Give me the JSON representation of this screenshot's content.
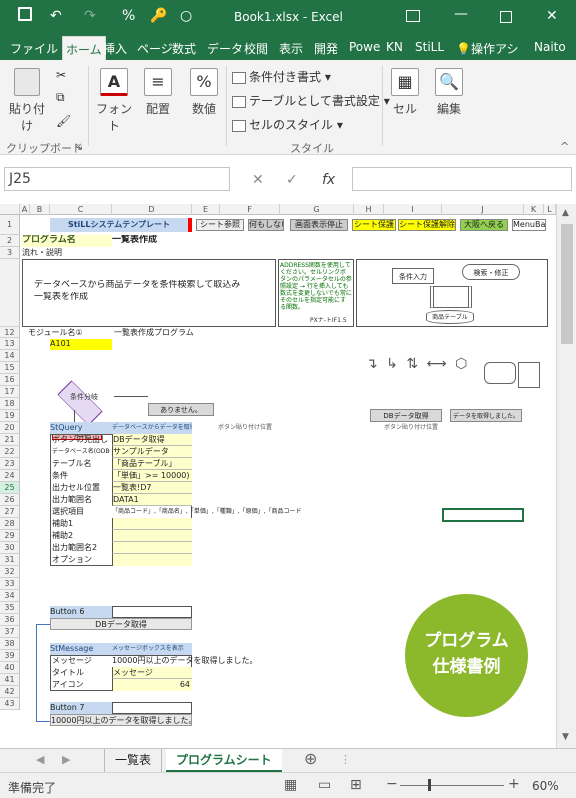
{
  "titlebar": {
    "title": "Book1.xlsx - Excel",
    "percent_icon": "%",
    "key_icon": "🔑",
    "circle_icon": "○"
  },
  "tabs": [
    "ファイル",
    "ホーム",
    "挿入",
    "ページ",
    "数式",
    "データ",
    "校閲",
    "表示",
    "開発",
    "Powe",
    "KN",
    "StiLL",
    "操作アシ",
    "Naito"
  ],
  "ribbon": {
    "paste": "貼り付け",
    "font": "フォント",
    "align": "配置",
    "number": "数値",
    "cond": "条件付き書式",
    "table": "テーブルとして書式設定",
    "style": "セルのスタイル",
    "cell": "セル",
    "edit": "編集",
    "clip_grp": "クリップボード",
    "style_grp": "スタイル",
    "font_glyph": "A",
    "num_glyph": "%"
  },
  "formula": {
    "namebox": "J25",
    "fx": "fx"
  },
  "cols": [
    "A",
    "B",
    "C",
    "D",
    "E",
    "F",
    "G",
    "H",
    "I",
    "J",
    "K",
    "L"
  ],
  "rows": [
    "1",
    "2",
    "3",
    "12",
    "13",
    "14",
    "15",
    "16",
    "17",
    "18",
    "19",
    "20",
    "21",
    "22",
    "23",
    "24",
    "25",
    "26",
    "27",
    "28",
    "29",
    "30",
    "31",
    "32",
    "33",
    "34",
    "35",
    "36",
    "37",
    "38",
    "39",
    "40",
    "41",
    "42",
    "43"
  ],
  "cells": {
    "template": "StiLLシステムテンプレート",
    "b1": "シート参照",
    "b2": "何もしない",
    "b3": "画面表示停止",
    "b4": "シート保護",
    "b5": "シート保護解除",
    "b6": "大阪へ戻る",
    "b7": "MenuBar",
    "prog_label": "プログラム名",
    "prog_name": "一覧表作成",
    "flow": "流れ・説明",
    "desc1": "データベースから商品データを条件検索して取込み",
    "desc2": "一覧表を作成",
    "note": "ADDRESS関数を使用してください。セルリンクボタンのパラメータセルの参照設定 → 行を挿入しても数式を変更しないでも常にそのセルを指定可能にする関数。",
    "note_footer": "PXナ-トIF1.5",
    "fc_input": "条件入力",
    "fc_search": "検索・修正",
    "fc_table": "商品テーブル",
    "mod_label": "モジュール名①",
    "mod_name": "一覧表作成プログラム",
    "a101": "A101",
    "cond_branch": "条件分岐",
    "none": "ありません。",
    "listbtn": "一覧表",
    "db_btn": "DBデータ取得",
    "db_ok": "データを取得しました。",
    "stq": "StQuery",
    "stq_desc": "データベースからデータを取得",
    "btn_pos1": "ボタン貼り付け位置",
    "btn_pos2": "ボタン貼り付け位置",
    "r21a": "ボタンの見出し",
    "r21b": "DBデータ取得",
    "r22a": "データベース名(ODBC)",
    "r22b": "サンプルデータ",
    "r23a": "テーブル名",
    "r23b": "「商品テーブル」",
    "r24a": "条件",
    "r24b": "「単価」>= 10000)",
    "r25a": "出力セル位置",
    "r25b": "一覧表!D7",
    "r26a": "出力範囲名",
    "r26b": "DATA1",
    "r27a": "選択項目",
    "r27b": "「商品コード」,「商品名」,「単価」,「種類」,「原価」,「商品コード",
    "r28a": "補助1",
    "r29a": "補助2",
    "r30a": "出力範囲名2",
    "r31a": "オプション",
    "btn6": "Button 6",
    "dbget": "DBデータ取得",
    "stmsg": "StMessage",
    "stmsg_desc": "メッセージボックスを表示",
    "r37a": "メッセージ",
    "r37b": "10000円以上のデータを取得しました。",
    "r38a": "タイトル",
    "r38b": "メッセージ",
    "r39a": "アイコン",
    "r39b": "64",
    "btn7": "Button 7",
    "r42": "10000円以上のデータを取得しました。"
  },
  "sheet_tabs": [
    "一覧表",
    "プログラムシート"
  ],
  "active_tab": "プログラムシート",
  "status": {
    "ready": "準備完了",
    "zoom": "60%"
  },
  "badge": {
    "line1": "プログラム",
    "line2": "仕様書例"
  },
  "colors": {
    "brand": "#217346",
    "badge": "#8cb82b",
    "yellow": "#ffff00",
    "lightyellow": "#ffffcc",
    "blue": "#c6d9f1"
  }
}
